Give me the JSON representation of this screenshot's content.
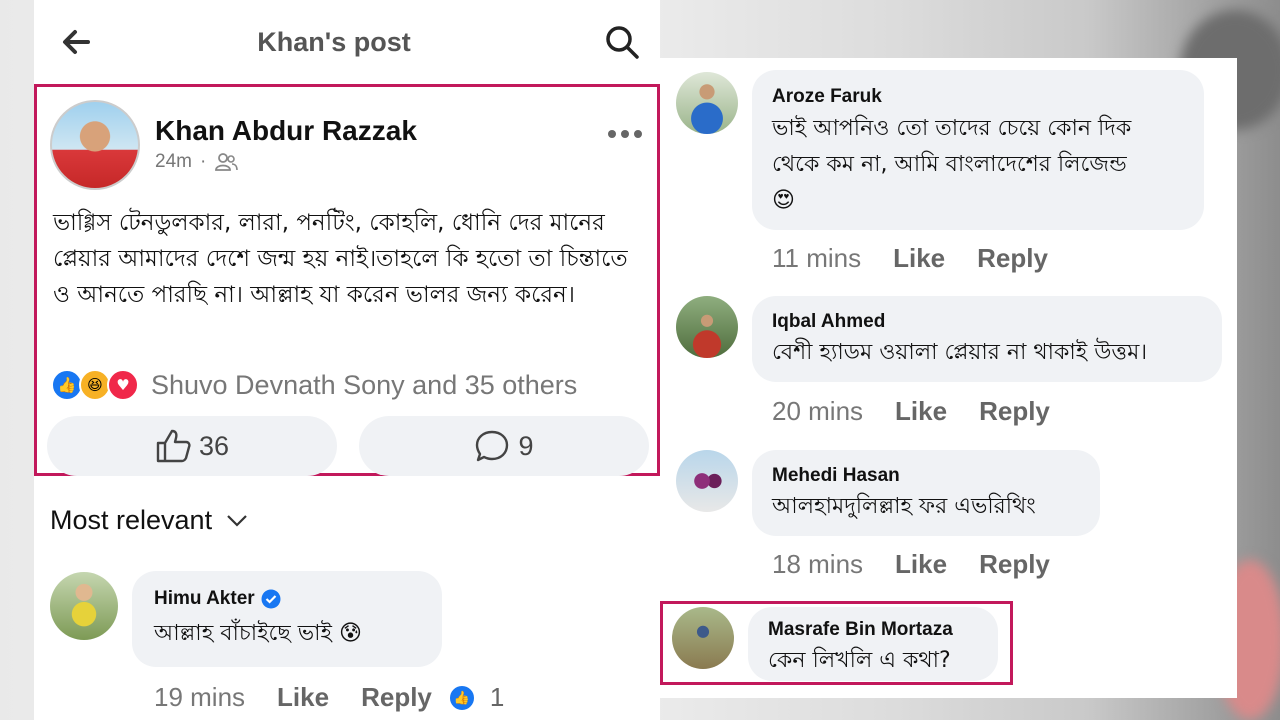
{
  "header": {
    "title": "Khan's post"
  },
  "post": {
    "author": "Khan Abdur Razzak",
    "time": "24m",
    "separator": "·",
    "body": "ভাগ্গিস টেনডুলকার, লারা, পনটিং, কোহলি, ধোনি দের মানের প্লেয়ার আমাদের দেশে জন্ম হয় নাই।তাহলে কি হতো তা চিন্তাতে ও আনতে পারছি না। আল্লাহ যা করেন ভালর জন্য করেন।",
    "reactions_text": "Shuvo Devnath Sony and 35 others",
    "like_count": "36",
    "comment_count": "9"
  },
  "sort": {
    "label": "Most relevant"
  },
  "comments_left": [
    {
      "name": "Himu Akter",
      "verified": true,
      "text": "আল্লাহ বাঁচাইছে ভাই",
      "emoji": "😰",
      "time": "19 mins",
      "like": "Like",
      "reply": "Reply",
      "like_count": "1"
    }
  ],
  "comments_right": [
    {
      "name": "Aroze Faruk",
      "line1": "ভাই আপনিও তো তাদের চেয়ে কোন দিক",
      "line2": "থেকে কম না, আমি বাংলাদেশের লিজেন্ড",
      "emoji": "😍",
      "time": "11 mins",
      "like": "Like",
      "reply": "Reply"
    },
    {
      "name": "Iqbal Ahmed",
      "text": "বেশী হ্যাডম ওয়ালা প্লেয়ার না থাকাই উত্তম।",
      "time": "20 mins",
      "like": "Like",
      "reply": "Reply"
    },
    {
      "name": "Mehedi Hasan",
      "text": "আলহামদুলিল্লাহ ফর এভরিথিং",
      "time": "18 mins",
      "like": "Like",
      "reply": "Reply"
    },
    {
      "name": "Masrafe Bin Mortaza",
      "text": "কেন লিখলি এ কথা?"
    }
  ],
  "icons": {
    "back": "arrow-left-icon",
    "search": "search-icon",
    "more": "more-horizontal-icon",
    "audience": "friends-icon",
    "like": "thumbs-up-icon",
    "comment": "speech-bubble-icon",
    "verified": "verified-badge-icon",
    "chevron": "chevron-down-icon"
  },
  "colors": {
    "accent_frame": "#c2185b",
    "like_blue": "#1877f2",
    "love_red": "#f0284a",
    "haha_yellow": "#f7b125"
  }
}
